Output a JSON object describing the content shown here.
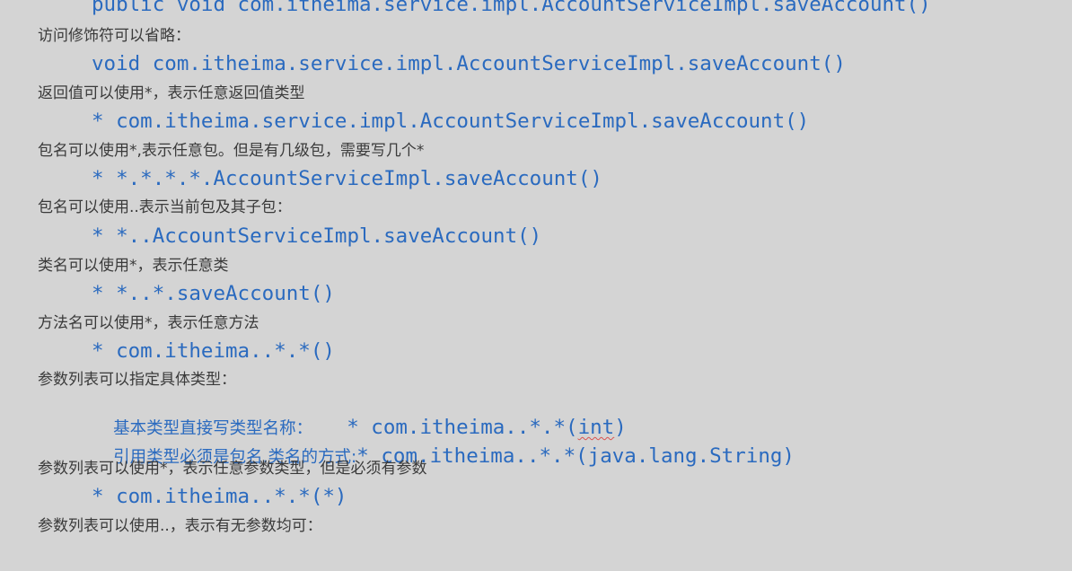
{
  "lines": {
    "l0": "public void com.itheima.service.impl.AccountServiceImpl.saveAccount()",
    "l1": "访问修饰符可以省略：",
    "l2": "void com.itheima.service.impl.AccountServiceImpl.saveAccount()",
    "l3": "返回值可以使用*，表示任意返回值类型",
    "l4": "* com.itheima.service.impl.AccountServiceImpl.saveAccount()",
    "l5": "包名可以使用*,表示任意包。但是有几级包，需要写几个*",
    "l6": "* *.*.*.*.AccountServiceImpl.saveAccount()",
    "l7": "包名可以使用..表示当前包及其子包：",
    "l8": "* *..AccountServiceImpl.saveAccount()",
    "l9": "类名可以使用*，表示任意类",
    "l10": "* *..*.saveAccount()",
    "l11": "方法名可以使用*，表示任意方法",
    "l12": "* com.itheima..*.*()",
    "l13": "参数列表可以指定具体类型：",
    "l14_label": "基本类型直接写类型名称：",
    "l14_code_pre": "* com.itheima..*.*(",
    "l14_code_int": "int",
    "l14_code_post": ")",
    "l15_label": "引用类型必须是包名.类名的方式:",
    "l15_code": "* com.itheima..*.*(java.lang.String)",
    "l16": "参数列表可以使用*，表示任意参数类型，但是必须有参数",
    "l17": "* com.itheima..*.*(*)",
    "l18": "参数列表可以使用..，表示有无参数均可："
  },
  "colors": {
    "background": "#d4d4d4",
    "code_text": "#2a6abf",
    "note_text": "#3a3a3a",
    "spellcheck_underline": "#d9534f"
  }
}
